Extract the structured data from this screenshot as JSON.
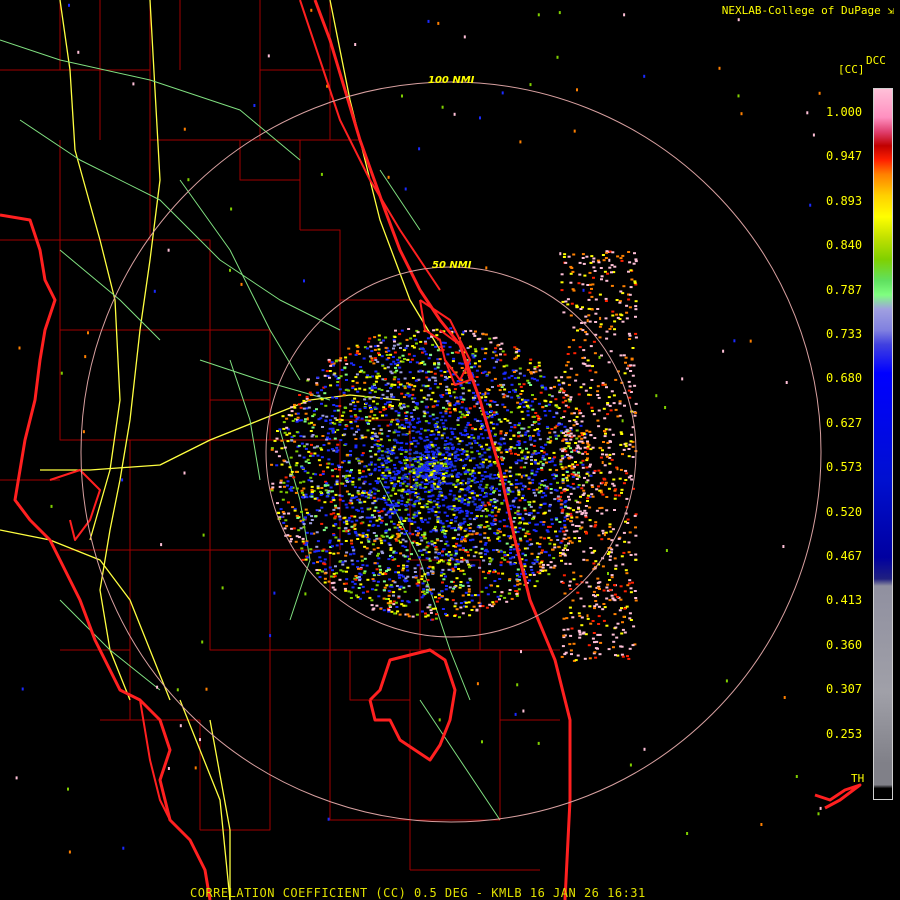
{
  "header": {
    "credit": "NEXLAB-College of DuPage",
    "credit_icon": "cursor-arrow-icon"
  },
  "footer": {
    "caption": "CORRELATION COEFFICIENT (CC) 0.5 DEG - KMLB 16 JAN 26 16:31"
  },
  "map": {
    "rings": [
      {
        "label": "100 NMI"
      },
      {
        "label": "50 NMI"
      }
    ],
    "colors": {
      "state_border": "#ff2020",
      "county": "#a00000",
      "road": "#ffff40",
      "minor_road": "#80e080",
      "ring": "#d8a0a0"
    }
  },
  "scale": {
    "title_top": "DCC",
    "title_unit": "[CC]",
    "ticks": [
      "1.000",
      "0.947",
      "0.893",
      "0.840",
      "0.787",
      "0.733",
      "0.680",
      "0.627",
      "0.573",
      "0.520",
      "0.467",
      "0.413",
      "0.360",
      "0.307",
      "0.253"
    ],
    "threshold_label": "TH"
  }
}
